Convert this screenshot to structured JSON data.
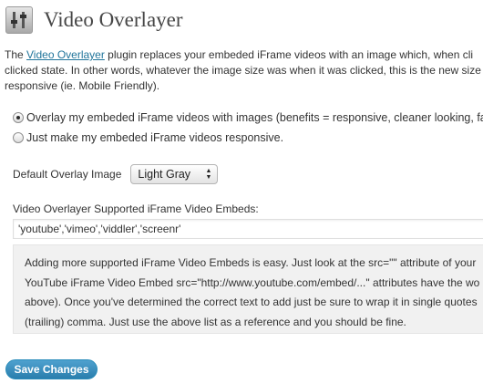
{
  "header": {
    "title": "Video Overlayer",
    "icon": "settings-sliders-icon"
  },
  "intro": {
    "prefix": "The ",
    "plugin_link": "Video Overlayer",
    "line1_rest": " plugin replaces your embeded iFrame videos with an image which, when cli",
    "line2": "clicked state. In other words, whatever the image size was when it was clicked, this is the new size",
    "line3": "responsive (ie. Mobile Friendly)."
  },
  "options": [
    {
      "label": "Overlay my embeded iFrame videos with images (benefits = responsive, cleaner looking, fas",
      "checked": true
    },
    {
      "label": "Just make my embeded iFrame videos responsive.",
      "checked": false
    }
  ],
  "overlay_image": {
    "label": "Default Overlay Image",
    "selected": "Light Gray"
  },
  "embeds": {
    "label": "Video Overlayer Supported iFrame Video Embeds:",
    "value": "'youtube','vimeo','viddler','screenr'"
  },
  "info": {
    "line1": "Adding more supported iFrame Video Embeds is easy. Just look at the src=\"\" attribute of your",
    "line2": "YouTube iFrame Video Embed src=\"http://www.youtube.com/embed/...\" attributes have the wo",
    "line3": "above). Once you've determined the correct text to add just be sure to wrap it in single quotes",
    "line4": "(trailing) comma. Just use the above list as a reference and you should be fine."
  },
  "save_label": "Save Changes",
  "colors": {
    "link": "#21759b",
    "button": "#2a7ead",
    "info_bg": "#f1f1f1"
  }
}
